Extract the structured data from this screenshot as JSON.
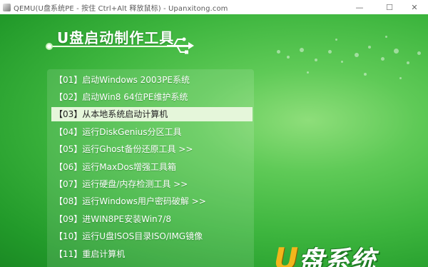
{
  "window": {
    "title": "QEMU(U盘系统PE - 按住 Ctrl+Alt 释放鼠标) - Upanxitong.com",
    "minimize": "—",
    "maximize": "☐",
    "close": "✕"
  },
  "boot": {
    "heading": "U盘启动制作工具",
    "selected_index": 2,
    "items": [
      {
        "label": "【01】启动Windows 2003PE系统"
      },
      {
        "label": "【02】启动Win8 64位PE维护系统"
      },
      {
        "label": "【03】从本地系统启动计算机"
      },
      {
        "label": "【04】运行DiskGenius分区工具"
      },
      {
        "label": "【05】运行Ghost备份还原工具 >>"
      },
      {
        "label": "【06】运行MaxDos增强工具箱"
      },
      {
        "label": "【07】运行硬盘/内存检测工具 >>"
      },
      {
        "label": "【08】运行Windows用户密码破解 >>"
      },
      {
        "label": "【09】进WIN8PE安装Win7/8"
      },
      {
        "label": "【10】运行U盘ISOS目录ISO/IMG镜像"
      },
      {
        "label": "【11】重启计算机"
      }
    ],
    "logo": {
      "u": "U",
      "rest": "盘系统"
    }
  },
  "colors": {
    "background_green": "#3db53e",
    "selected_bg": "#e5f6da",
    "logo_u": "#f2b61b"
  }
}
